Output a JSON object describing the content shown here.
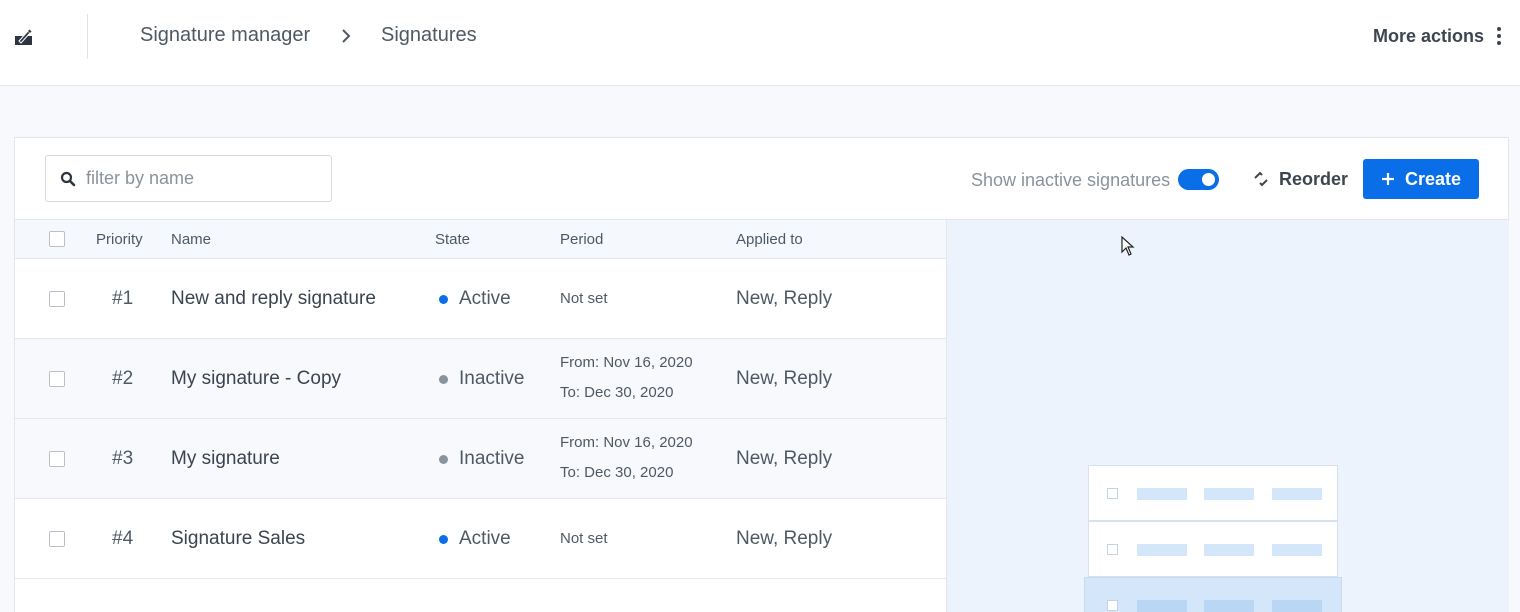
{
  "header": {
    "app_icon": "edit-signature-icon",
    "breadcrumb": [
      "Signature manager",
      "Signatures"
    ],
    "more_actions_label": "More actions"
  },
  "toolbar": {
    "search_placeholder": "filter by name",
    "show_inactive_label": "Show inactive signatures",
    "show_inactive_on": true,
    "reorder_label": "Reorder",
    "create_label": "Create"
  },
  "table": {
    "columns": [
      "Priority",
      "Name",
      "State",
      "Period",
      "Applied to"
    ],
    "rows": [
      {
        "priority": "#1",
        "name": "New and reply signature",
        "state": "Active",
        "period": "Not set",
        "applied_to": "New, Reply"
      },
      {
        "priority": "#2",
        "name": "My signature - Copy",
        "state": "Inactive",
        "period_from": "From: Nov 16, 2020",
        "period_to": "To: Dec 30, 2020",
        "applied_to": "New, Reply"
      },
      {
        "priority": "#3",
        "name": "My signature",
        "state": "Inactive",
        "period_from": "From: Nov 16, 2020",
        "period_to": "To: Dec 30, 2020",
        "applied_to": "New, Reply"
      },
      {
        "priority": "#4",
        "name": "Signature Sales",
        "state": "Active",
        "period": "Not set",
        "applied_to": "New, Reply"
      }
    ]
  },
  "colors": {
    "accent": "#0a6ee8",
    "active_dot": "#0a6ee8",
    "inactive_dot": "#8a939c",
    "preview_bg": "#ecf3fc"
  }
}
